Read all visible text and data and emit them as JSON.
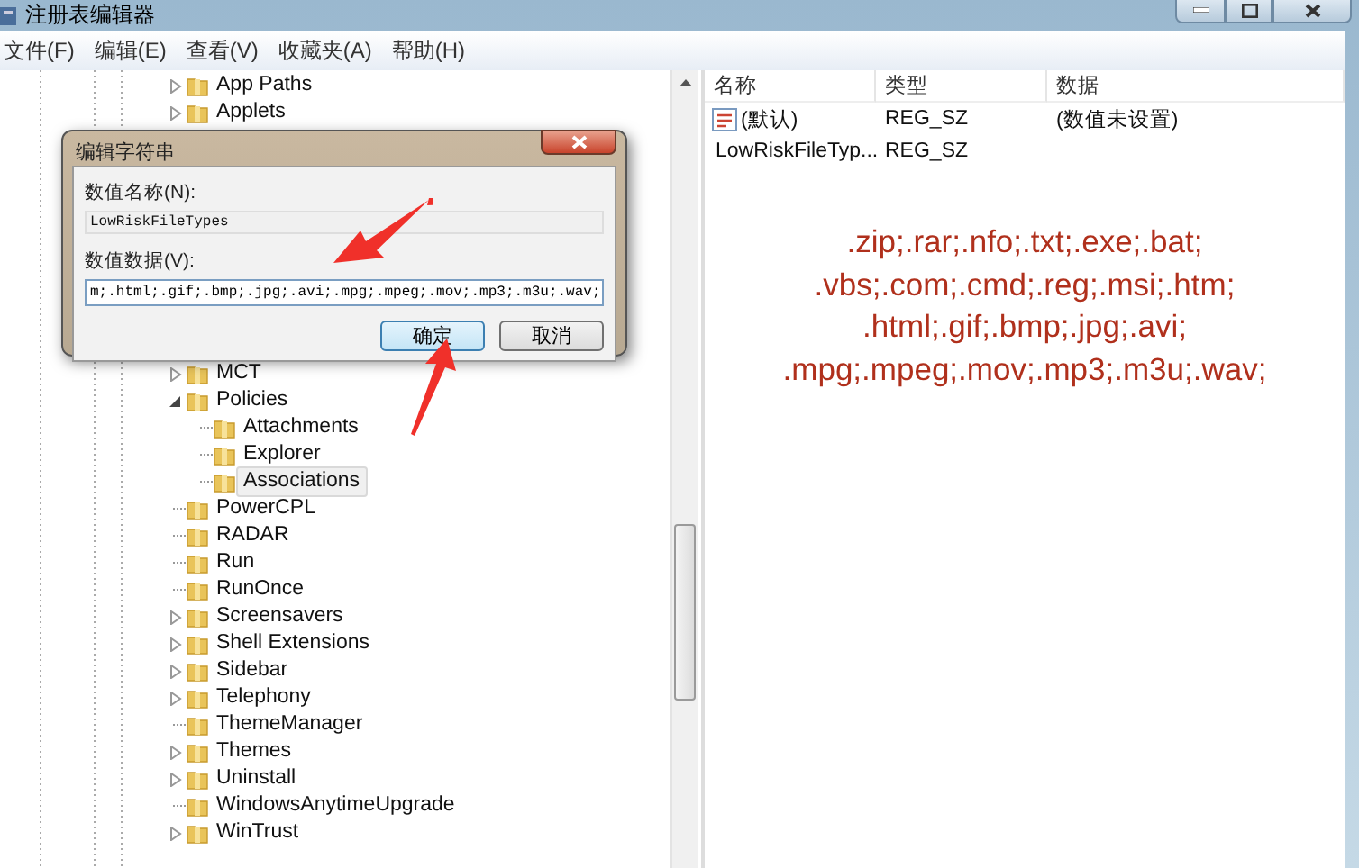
{
  "window": {
    "title": "注册表编辑器"
  },
  "menu": [
    "文件(F)",
    "编辑(E)",
    "查看(V)",
    "收藏夹(A)",
    "帮助(H)"
  ],
  "tree_top": [
    {
      "label": "App Paths",
      "expandable": true,
      "expanded": false,
      "selected": false
    },
    {
      "label": "Applets",
      "expandable": true,
      "expanded": false,
      "selected": false
    }
  ],
  "tree_bottom": [
    {
      "label": "MCT",
      "expandable": true,
      "expanded": false,
      "selected": false
    },
    {
      "label": "Policies",
      "expandable": true,
      "expanded": true,
      "selected": false,
      "children": [
        {
          "label": "Attachments",
          "expandable": false,
          "selected": false
        },
        {
          "label": "Explorer",
          "expandable": false,
          "selected": false
        },
        {
          "label": "Associations",
          "expandable": false,
          "selected": true
        }
      ]
    },
    {
      "label": "PowerCPL",
      "expandable": false,
      "selected": false
    },
    {
      "label": "RADAR",
      "expandable": false,
      "selected": false
    },
    {
      "label": "Run",
      "expandable": false,
      "selected": false
    },
    {
      "label": "RunOnce",
      "expandable": false,
      "selected": false
    },
    {
      "label": "Screensavers",
      "expandable": true,
      "expanded": false,
      "selected": false
    },
    {
      "label": "Shell Extensions",
      "expandable": true,
      "expanded": false,
      "selected": false
    },
    {
      "label": "Sidebar",
      "expandable": true,
      "expanded": false,
      "selected": false
    },
    {
      "label": "Telephony",
      "expandable": true,
      "expanded": false,
      "selected": false
    },
    {
      "label": "ThemeManager",
      "expandable": false,
      "selected": false
    },
    {
      "label": "Themes",
      "expandable": true,
      "expanded": false,
      "selected": false
    },
    {
      "label": "Uninstall",
      "expandable": true,
      "expanded": false,
      "selected": false
    },
    {
      "label": "WindowsAnytimeUpgrade",
      "expandable": false,
      "selected": false
    },
    {
      "label": "WinTrust",
      "expandable": true,
      "expanded": false,
      "selected": false
    }
  ],
  "values_table": {
    "columns": [
      "名称",
      "类型",
      "数据"
    ],
    "rows": [
      {
        "name": "(默认)",
        "type": "REG_SZ",
        "data": "(数值未设置)",
        "kind": "default"
      },
      {
        "name": "LowRiskFileTyp...",
        "type": "REG_SZ",
        "data": "",
        "kind": "string"
      }
    ]
  },
  "annotation_lines": [
    ".zip;.rar;.nfo;.txt;.exe;.bat;",
    ".vbs;.com;.cmd;.reg;.msi;.htm;",
    ".html;.gif;.bmp;.jpg;.avi;",
    ".mpg;.mpeg;.mov;.mp3;.m3u;.wav;"
  ],
  "dialog": {
    "title": "编辑字符串",
    "name_label": "数值名称(N):",
    "name_value": "LowRiskFileTypes",
    "data_label": "数值数据(V):",
    "data_value": "m;.html;.gif;.bmp;.jpg;.avi;.mpg;.mpeg;.mov;.mp3;.m3u;.wav;",
    "buttons": [
      {
        "label": "确定",
        "default": true
      },
      {
        "label": "取消",
        "default": false
      }
    ]
  }
}
